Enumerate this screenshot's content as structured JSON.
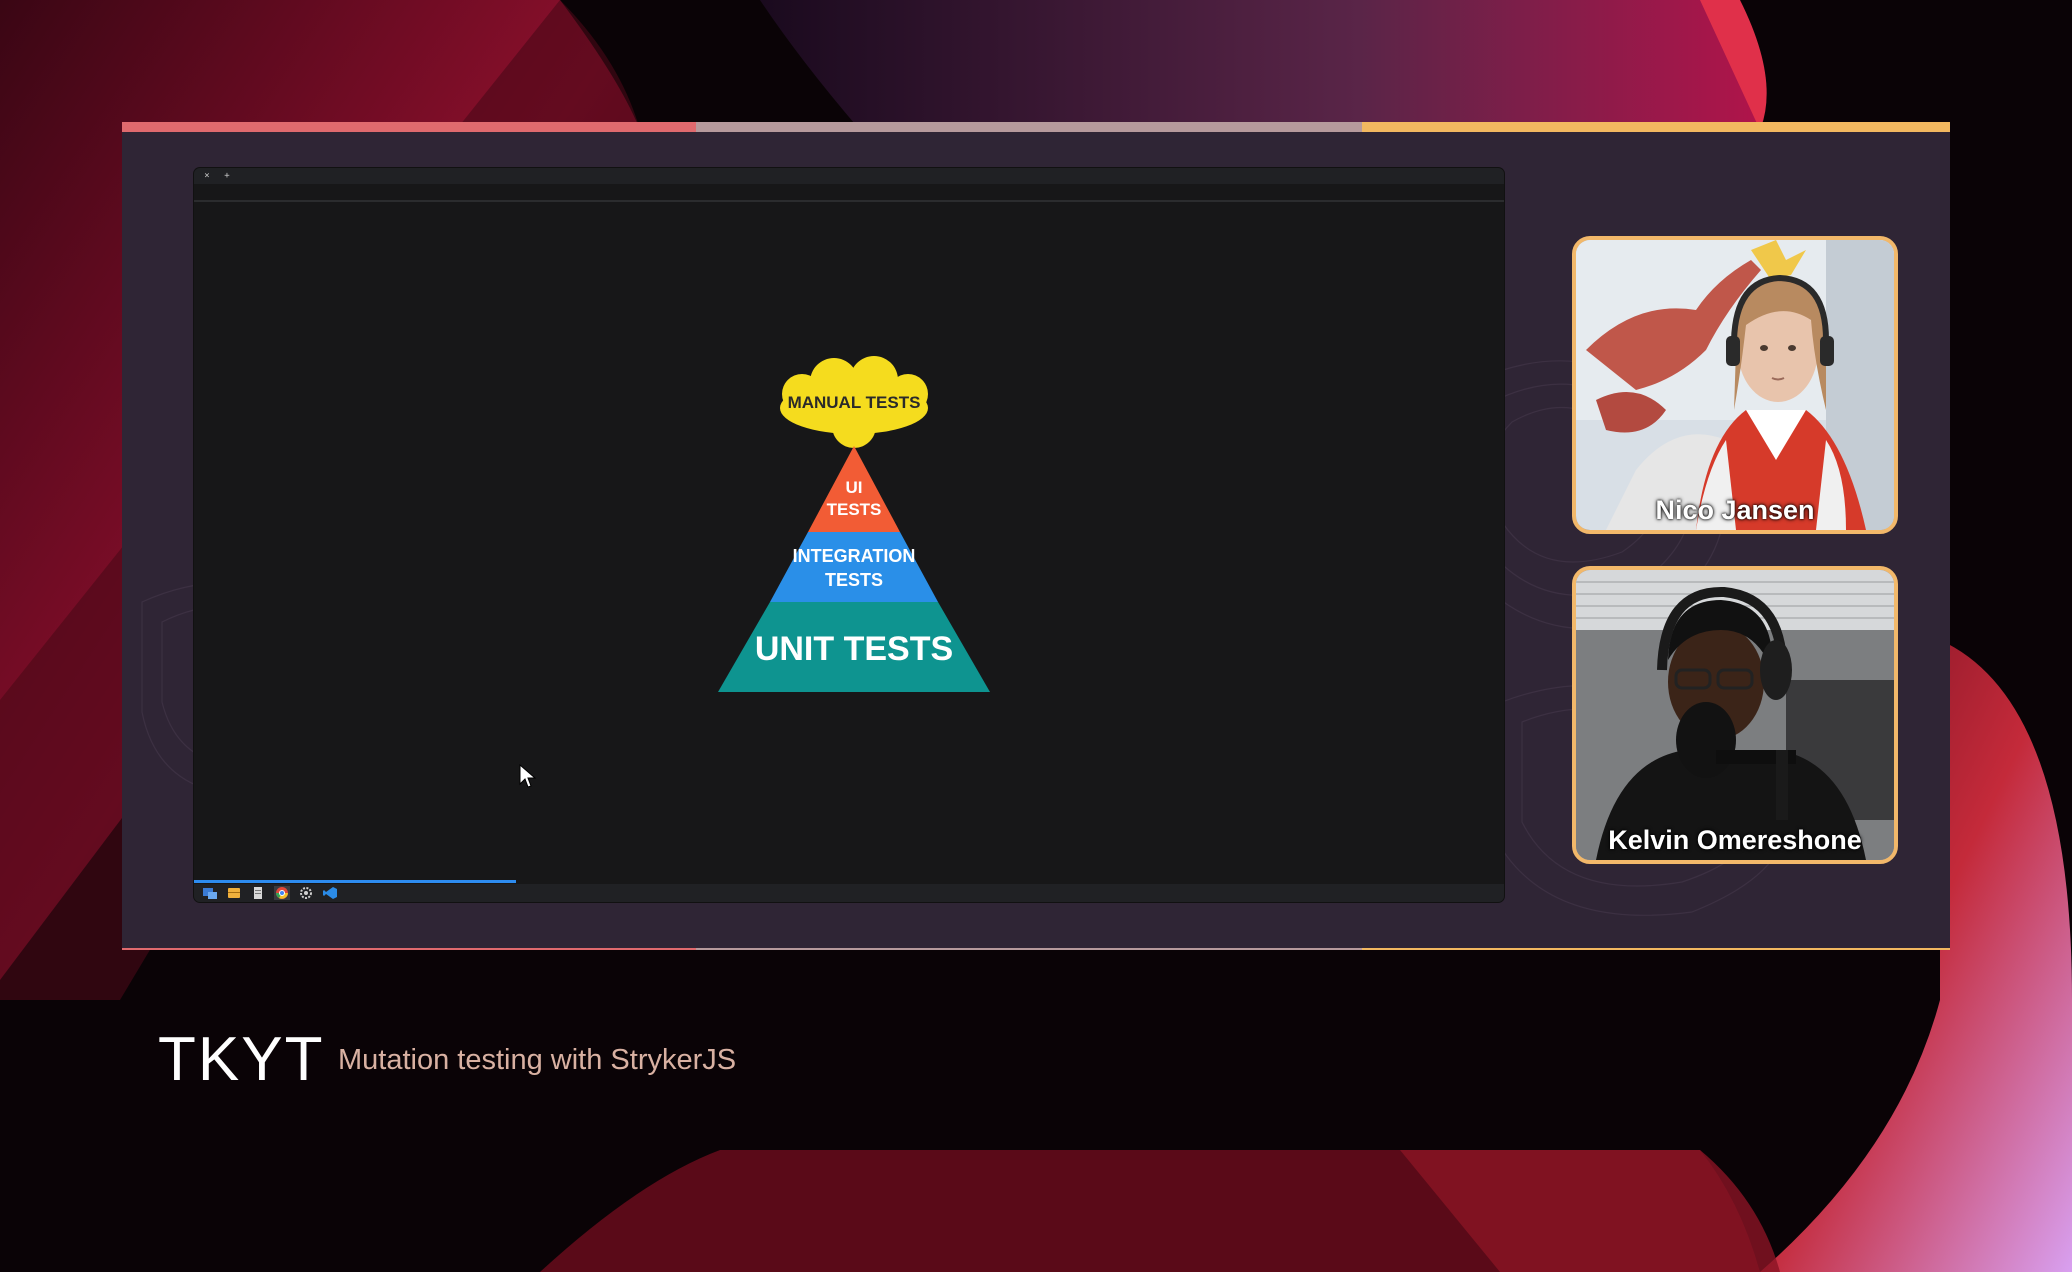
{
  "colors": {
    "frame_bg": "#2f2535",
    "accent_segments": [
      "#e06a6e",
      "#b69a9c",
      "#f2b860"
    ],
    "cam_border": "#f2b86a"
  },
  "screen_share": {
    "tab_icons": [
      "close-icon",
      "plus-icon"
    ],
    "tab_glyphs": [
      "×",
      "+"
    ],
    "slide": {
      "top": "MANUAL TESTS",
      "layers": [
        {
          "lines": [
            "UI",
            "TESTS"
          ],
          "color": "#f25c35"
        },
        {
          "lines": [
            "INTEGRATION",
            "TESTS"
          ],
          "color": "#2a8fe8"
        },
        {
          "lines": [
            "UNIT TESTS"
          ],
          "color": "#0e9490"
        }
      ],
      "cloud_color": "#f5dc1e"
    },
    "taskbar_icons": [
      "explorer-icon",
      "folder-icon",
      "document-icon",
      "chrome-icon",
      "settings-icon",
      "vscode-icon"
    ]
  },
  "participants": [
    {
      "name": "Nico Jansen"
    },
    {
      "name": "Kelvin Omereshone"
    }
  ],
  "lower_third": {
    "show": "TKYT",
    "title": "Mutation testing with StrykerJS"
  }
}
